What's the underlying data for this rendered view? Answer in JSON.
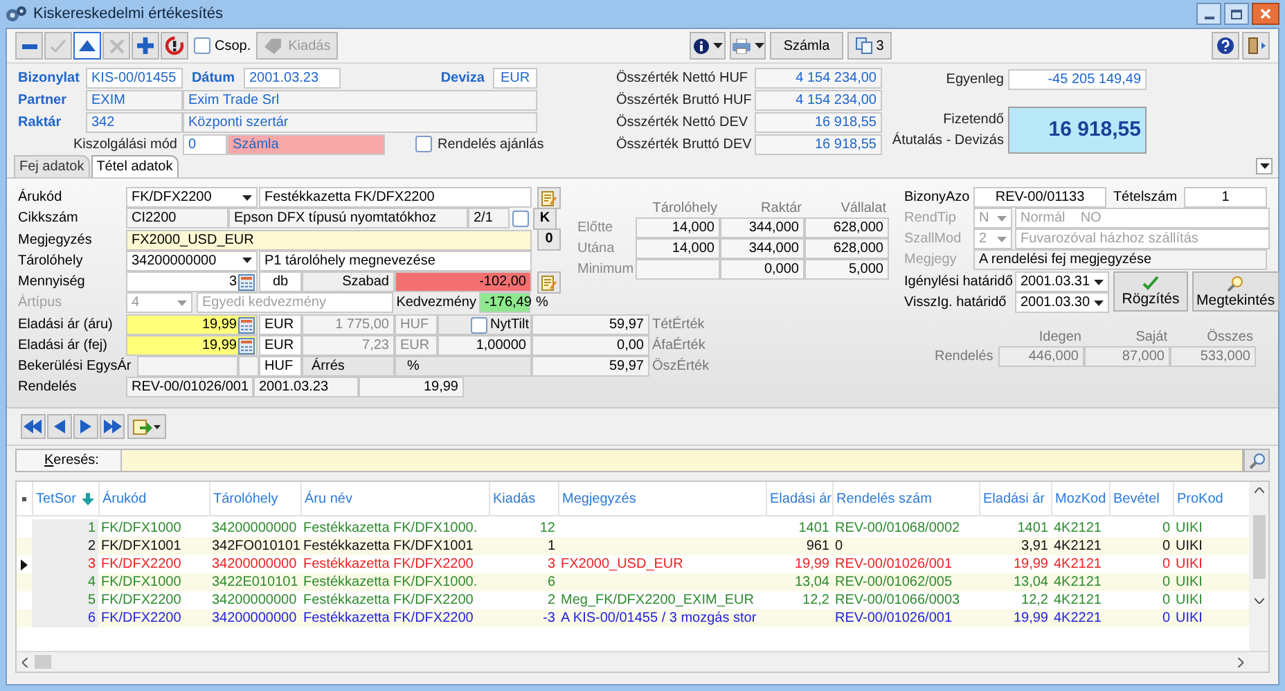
{
  "window": {
    "title": "Kiskereskedelmi értékesítés"
  },
  "toolbar": {
    "buttons": [
      {
        "kind": "minus",
        "disabled": false,
        "pressed": false
      },
      {
        "kind": "check",
        "disabled": true,
        "pressed": false
      },
      {
        "kind": "up",
        "disabled": false,
        "pressed": true
      },
      {
        "kind": "delete",
        "disabled": true,
        "pressed": false
      },
      {
        "kind": "plus",
        "disabled": false,
        "pressed": false
      },
      {
        "kind": "alert",
        "disabled": false,
        "pressed": false
      }
    ],
    "group": {
      "label": "Csop.",
      "checked": false
    },
    "issue_button": {
      "label": "Kiadás",
      "disabled": true
    },
    "invoice_button": "Számla",
    "copies_button": "3"
  },
  "header": {
    "document": {
      "label": "Bizonylat",
      "value": "KIS-00/01455"
    },
    "date": {
      "label": "Dátum",
      "value": "2001.03.23"
    },
    "currency": {
      "label": "Deviza",
      "value": "EUR"
    },
    "partner": {
      "label": "Partner",
      "code": "EXIM",
      "name": "Exim Trade Srl"
    },
    "warehouse": {
      "label": "Raktár",
      "code": "342",
      "name": "Központi szertár"
    },
    "service_mode": {
      "label": "Kiszolgálási mód",
      "code": "0",
      "name": "Számla"
    },
    "order_offer": {
      "label": "Rendelés ajánlás",
      "checked": false
    },
    "totals": [
      {
        "label": "Összérték Nettó HUF",
        "value": "4 154 234,00"
      },
      {
        "label": "Összérték Bruttó HUF",
        "value": "4 154 234,00"
      },
      {
        "label": "Összérték Nettó DEV",
        "value": "16 918,55"
      },
      {
        "label": "Összérték Bruttó DEV",
        "value": "16 918,55"
      }
    ],
    "balance": {
      "label": "Egyenleg",
      "value": "-45 205 149,49"
    },
    "payable": {
      "label": "Fizetendő",
      "sublabel": "Átutalás - Devizás",
      "value": "16 918,55"
    }
  },
  "tabs": [
    {
      "label": "Fej adatok",
      "selected": false
    },
    {
      "label": "Tétel adatok",
      "selected": true
    }
  ],
  "item": {
    "product": {
      "label": "Árukód",
      "code": "FK/DFX2200",
      "name": "Festékkazetta FK/DFX2200"
    },
    "article": {
      "label": "Cikkszám",
      "code": "CI2200",
      "description": "Epson DFX típusú nyomtatókhoz",
      "ratio": "2/1",
      "checked": false,
      "button": "K"
    },
    "note": {
      "label": "Megjegyzés",
      "value": "FX2000_USD_EUR",
      "button": "0"
    },
    "location": {
      "label": "Tárolóhely",
      "code": "34200000000",
      "name": "P1 tárolóhely megnevezése"
    },
    "quantity": {
      "label": "Mennyiség",
      "value": "3",
      "unit": "db",
      "free_label": "Szabad",
      "free_value": "-102,00"
    },
    "price_type": {
      "label": "Ártípus",
      "disabled": true,
      "code": "4",
      "name": "Egyedi kedvezmény",
      "discount_label": "Kedvezmény",
      "discount_value": "-176,49",
      "percent": "%"
    },
    "price_item": {
      "label": "Eladási ár (áru)",
      "value": "19,99",
      "currency": "EUR",
      "converted": "1 775,00",
      "converted_currency": "HUF",
      "no_tax": {
        "label": "NytTilt",
        "checked": false
      },
      "total": "59,97",
      "total_label": "TétÉrték"
    },
    "price_head": {
      "label": "Eladási ár (fej)",
      "value": "19,99",
      "currency": "EUR",
      "converted": "7,23",
      "converted_currency": "EUR",
      "rate": "1,00000",
      "total": "0,00",
      "total_label": "ÁfaÉrték"
    },
    "cost": {
      "label": "Bekerülési EgysÁr",
      "currency": "HUF",
      "margin_label": "Árrés",
      "percent": "%",
      "total": "59,97",
      "total_label": "ÖszÉrték"
    },
    "order": {
      "label": "Rendelés",
      "number": "REV-00/01026/001",
      "date": "2001.03.23",
      "price": "19,99"
    }
  },
  "stock": {
    "columns": [
      "Tárolóhely",
      "Raktár",
      "Vállalat"
    ],
    "rows": [
      {
        "label": "Előtte",
        "location": "14,000",
        "warehouse": "344,000",
        "company": "628,000"
      },
      {
        "label": "Utána",
        "location": "14,000",
        "warehouse": "344,000",
        "company": "628,000"
      },
      {
        "label": "Minimum",
        "warehouse": "0,000",
        "company": "5,000"
      }
    ]
  },
  "order_panel": {
    "doc_label": "BizonyAzo",
    "doc_value": "REV-00/01133",
    "item_no_label": "Tételszám",
    "item_no": "1",
    "rows": [
      {
        "label": "RendTip",
        "code": "N",
        "name": "Normál    NO",
        "disabled": true
      },
      {
        "label": "SzallMod",
        "code": "2",
        "name": "Fuvarozóval házhoz szállítás",
        "disabled": true
      }
    ],
    "note": {
      "label": "Megjegy",
      "value": "A rendelési fej megjegyzése",
      "disabled": true
    },
    "deadlines": [
      {
        "label": "Igénylési határidő",
        "value": "2001.03.31"
      },
      {
        "label": "VisszIg. határidő",
        "value": "2001.03.30"
      }
    ],
    "buttons": [
      {
        "kind": "save",
        "label": "Rögzítés"
      },
      {
        "kind": "view",
        "label": "Megtekintés"
      }
    ]
  },
  "order_summary": {
    "label": "Rendelés",
    "columns": [
      "Idegen",
      "Saját",
      "Összes"
    ],
    "values": [
      "446,000",
      "87,000",
      "533,000"
    ]
  },
  "nav_buttons": [
    {
      "kind": "first"
    },
    {
      "kind": "prev"
    },
    {
      "kind": "next"
    },
    {
      "kind": "last"
    },
    {
      "kind": "export"
    }
  ],
  "search": {
    "label": "Keresés:"
  },
  "table": {
    "columns": [
      "TetSor",
      "Árukód",
      "Tárolóhely",
      "Áru név",
      "Kiadás",
      "Megjegyzés",
      "Eladási ár",
      "Rendelés szám",
      "Eladási ár",
      "MozKod",
      "Bevétel",
      "ProKod"
    ],
    "rows": [
      {
        "selected": false,
        "color": "#2e8b2e",
        "cells": [
          "1",
          "FK/DFX1000",
          "34200000000",
          "Festékkazetta FK/DFX1000.",
          "12",
          null,
          "1401",
          "REV-00/01068/0002",
          "1401",
          "4K2121",
          "0",
          "UIKI"
        ]
      },
      {
        "selected": false,
        "color": "#111111",
        "cells": [
          "2",
          "FK/DFX1001",
          "342FO010101",
          "Festékkazetta FK/DFX1001",
          "1",
          null,
          "961",
          "0",
          "3,91",
          "4K2121",
          "0",
          "UIKI"
        ]
      },
      {
        "selected": true,
        "color": "#ee2222",
        "cells": [
          "3",
          "FK/DFX2200",
          "34200000000",
          "Festékkazetta FK/DFX2200",
          "3",
          "FX2000_USD_EUR",
          "19,99",
          "REV-00/01026/001",
          "19,99",
          "4K2121",
          "0",
          "UIKI"
        ]
      },
      {
        "selected": false,
        "color": "#2e8b2e",
        "cells": [
          "4",
          "FK/DFX1000",
          "3422E010101",
          "Festékkazetta FK/DFX1000.",
          "6",
          null,
          "13,04",
          "REV-00/01062/005",
          "13,04",
          "4K2121",
          "0",
          "UIKI"
        ]
      },
      {
        "selected": false,
        "color": "#2e8b2e",
        "cells": [
          "5",
          "FK/DFX2200",
          "34200000000",
          "Festékkazetta FK/DFX2200",
          "2",
          "Meg_FK/DFX2200_EXIM_EUR",
          "12,2",
          "REV-00/01066/0003",
          "12,2",
          "4K2121",
          "0",
          "UIKI"
        ]
      },
      {
        "selected": false,
        "color": "#2222dd",
        "cells": [
          "6",
          "FK/DFX2200",
          "34200000000",
          "Festékkazetta FK/DFX2200",
          "-3",
          "A KIS-00/01455 / 3 mozgás stor",
          null,
          "REV-00/01026/001",
          "19,99",
          "4K2221",
          "0",
          "UIKI"
        ]
      }
    ]
  }
}
